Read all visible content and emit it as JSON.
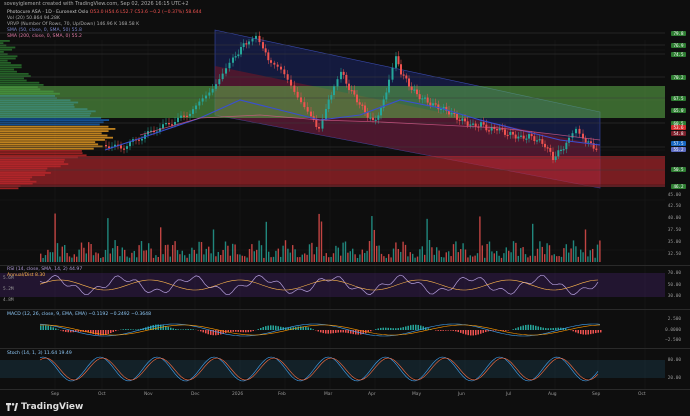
{
  "credit": "soveyiglement created with TradingView.com, Sep 02, 2026 16:15 UTC+2",
  "legends": {
    "main": "Photocure ASA · 1D · Euronext Oslo",
    "main_values": "O53.0 H54.6 L52.7 C53.6 −0.2 (−0.37%)  58.644",
    "vol": "Vol (20)  50.864  94.28K",
    "vrvp": "VRVP (Number Of Rows, 70, Up/Down)  146.96 K  168.58 K",
    "sma50": "SMA (50, close, 0, SMA, 50)  55.8",
    "sma200": "SMA (200, close, 0, SMA, 0)  55.2",
    "rsi": "RSI (14, close, SMA, 14, 2)  44.97",
    "rsi_sub": "Annual/Dist  8.30",
    "macd": "MACD (12, 26, close, 9, EMA, EMA)  −0.1192  −0.2492  −0.3648",
    "stoch": "Stoch (14, 1, 3)  11.64  19.49"
  },
  "price_tags": [
    {
      "label": "79.8",
      "color": "#2e7d32"
    },
    {
      "label": "76.9",
      "color": "#2e7d32"
    },
    {
      "label": "74.5",
      "color": "#2e7d32"
    },
    {
      "label": "70.2",
      "color": "#2e7d32"
    },
    {
      "label": "67.5",
      "color": "#2e7d32"
    },
    {
      "label": "65.0",
      "color": "#2e7d32"
    },
    {
      "label": "60.5",
      "color": "#2e7d32"
    },
    {
      "label": "57.5",
      "color": "#1565c0"
    },
    {
      "label": "55.2",
      "color": "#5c6bc0"
    },
    {
      "label": "53.6",
      "color": "#d32f2f"
    },
    {
      "label": "54.8",
      "color": "#7b1f2a"
    },
    {
      "label": "50.5",
      "color": "#2e7d32"
    },
    {
      "label": "46.2",
      "color": "#2e7d32"
    }
  ],
  "axis_labels": [
    "45.00",
    "42.50",
    "40.00",
    "37.50",
    "35.00",
    "32.50"
  ],
  "rsi_axis": [
    "70.00",
    "50.00",
    "30.00"
  ],
  "macd_axis": [
    "2.500",
    "0.0000",
    "−2.500"
  ],
  "stoch_axis": [
    "80.00",
    "20.00"
  ],
  "left_axis": [
    "5.6M",
    "5.2M",
    "4.8M"
  ],
  "x_labels": [
    "Sep",
    "Oct",
    "Nov",
    "Dec",
    "2026",
    "Feb",
    "Mar",
    "Apr",
    "May",
    "Jun",
    "Jul",
    "Aug",
    "Sep",
    "Oct"
  ],
  "footer": {
    "brand": "TradingView"
  },
  "colors": {
    "up": "#26a69a",
    "down": "#ef5350",
    "green_zone": "#5fb04a",
    "red_zone": "#c0282e",
    "channel": "#1e2a8a"
  }
}
